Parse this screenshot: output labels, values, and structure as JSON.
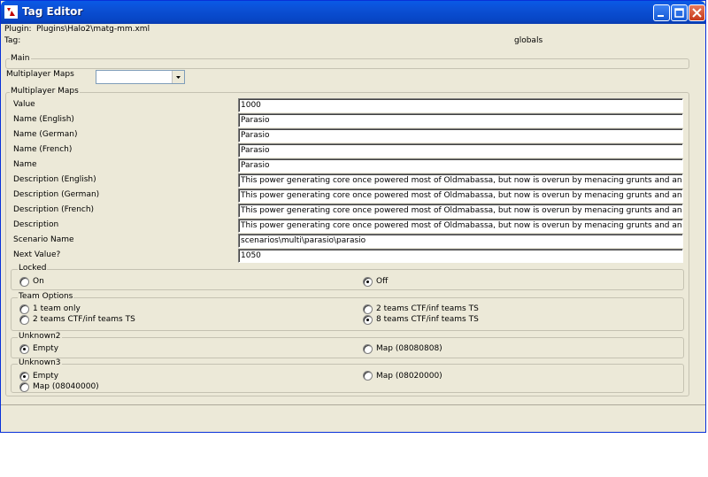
{
  "window": {
    "title": "Tag Editor"
  },
  "header": {
    "plugin_label": "Plugin:",
    "plugin_value": "Plugins\\Halo2\\matg-mm.xml",
    "tag_label": "Tag:",
    "tag_value": "globals"
  },
  "main": {
    "legend": "Main",
    "multiplayer_maps_label": "Multiplayer Maps",
    "multiplayer_maps_value": ""
  },
  "mp_section": {
    "legend": "Multiplayer Maps",
    "fields": [
      {
        "label": "Value",
        "value": "1000"
      },
      {
        "label": "Name (English)",
        "value": "Parasio"
      },
      {
        "label": "Name (German)",
        "value": "Parasio"
      },
      {
        "label": "Name (French)",
        "value": "Parasio"
      },
      {
        "label": "Name",
        "value": "Parasio"
      },
      {
        "label": "Description (English)",
        "value": "This power generating core once powered most of Oldmabassa, but now is overun by menacing grunts and an arid climate."
      },
      {
        "label": "Description (German)",
        "value": "This power generating core once powered most of Oldmabassa, but now is overun by menacing grunts and an arid climate."
      },
      {
        "label": "Description (French)",
        "value": "This power generating core once powered most of Oldmabassa, but now is overun by menacing grunts and an arid climate."
      },
      {
        "label": "Description",
        "value": "This power generating core once powered most of Oldmabassa, but now is overun by menacing grunts and an arid climate."
      },
      {
        "label": "Scenario Name",
        "value": "scenarios\\multi\\parasio\\parasio"
      },
      {
        "label": "Next Value?",
        "value": "1050"
      }
    ]
  },
  "locked": {
    "legend": "Locked",
    "on": "On",
    "off": "Off",
    "selected": "Off"
  },
  "team_options": {
    "legend": "Team Options",
    "opt1": "1 team only",
    "opt2": "2 teams CTF/inf teams TS",
    "opt3": "2 teams CTF/inf teams TS",
    "opt4": "8 teams CTF/inf teams TS",
    "selected": "8 teams CTF/inf teams TS"
  },
  "unknown2": {
    "legend": "Unknown2",
    "opt1": "Empty",
    "opt2": "Map (08080808)",
    "selected": "Empty"
  },
  "unknown3": {
    "legend": "Unknown3",
    "opt1": "Empty",
    "opt2": "Map (08020000)",
    "opt3": "Map (08040000)",
    "selected": "Empty"
  },
  "colors": {
    "titlebar": "#0b4fd4",
    "window_bg": "#ece9d8",
    "group_border": "#c5c2b2"
  }
}
